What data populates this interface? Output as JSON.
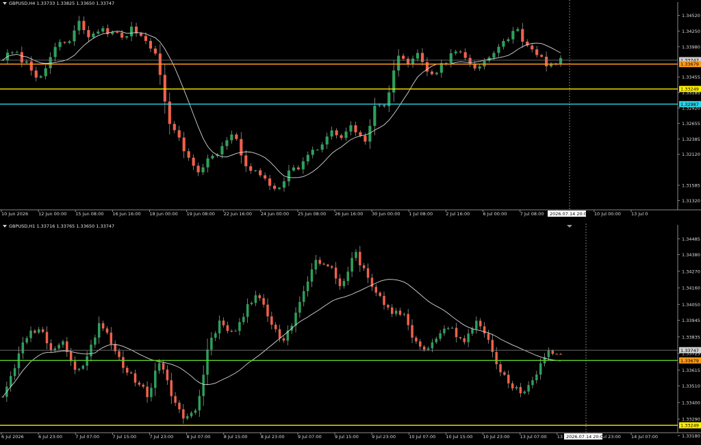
{
  "colors": {
    "background": "#000000",
    "bull": "#2ca05a",
    "bear": "#f0604a",
    "wick": "#b0b0b0",
    "ma": "#d8d8d8",
    "axis": "#8c8c8c",
    "text": "#dcdcdc",
    "orange": "#ff9a1a",
    "yellow": "#ffee00",
    "cyan": "#2ad4e6",
    "gray_line": "#8a8a8a",
    "green_line": "#5fd12c"
  },
  "chart_data": [
    {
      "type": "candlestick",
      "symbol_header": "GBPUSD,H4  1.33733 1.33825 1.33650 1.33747",
      "ylim": [
        1.3116,
        1.3468
      ],
      "yticks": [
        "1.34520",
        "1.34250",
        "1.33980",
        "1.33455",
        "1.33185",
        "1.32920",
        "1.32655",
        "1.32385",
        "1.32120",
        "1.31585",
        "1.31320"
      ],
      "ytick_values": [
        1.3452,
        1.3425,
        1.3398,
        1.33455,
        1.33185,
        1.3292,
        1.32655,
        1.32385,
        1.3212,
        1.31585,
        1.3132
      ],
      "xticks": [
        "10 Jun 2026",
        "12 Jun 00:00",
        "15 Jun 08:00",
        "16 Jun 16:00",
        "18 Jun 00:00",
        "19 Jun 08:00",
        "22 Jun 16:00",
        "24 Jun 00:00",
        "25 Jun 08:00",
        "26 Jun 16:00",
        "30 Jun 00:00",
        "1 Jul 08:00",
        "2 Jul 16:00",
        "6 Jul 00:00",
        "7 Jul 08:00",
        "8 Jul 16:00",
        "10 Jul 00:00",
        "13 Jul 0"
      ],
      "cursor_time": "2026.07.14 20:00",
      "levels": [
        {
          "label": "1.33747",
          "price": 1.33747,
          "color": "gray_line",
          "tag_bg": "#d0d0d0"
        },
        {
          "label": "1.33679",
          "price": 1.33679,
          "color": "orange",
          "tag_bg": "#ff9a1a"
        },
        {
          "label": "1.33249",
          "price": 1.33249,
          "color": "yellow",
          "tag_bg": "#ffee00"
        },
        {
          "label": "1.32987",
          "price": 1.32987,
          "color": "cyan",
          "tag_bg": "#2ad4e6"
        }
      ],
      "anchors": [
        1.3378,
        1.3388,
        1.3372,
        1.335,
        1.3355,
        1.3408,
        1.3402,
        1.344,
        1.341,
        1.3432,
        1.342,
        1.3415,
        1.343,
        1.341,
        1.339,
        1.328,
        1.324,
        1.3205,
        1.318,
        1.321,
        1.322,
        1.325,
        1.32,
        1.318,
        1.317,
        1.315,
        1.318,
        1.319,
        1.321,
        1.3225,
        1.325,
        1.324,
        1.326,
        1.323,
        1.329,
        1.33,
        1.338,
        1.337,
        1.3385,
        1.335,
        1.336,
        1.3385,
        1.339,
        1.336,
        1.3375,
        1.3385,
        1.341,
        1.343,
        1.3395,
        1.338,
        1.3365,
        1.3372
      ],
      "candles": 118,
      "seed": 7,
      "ma_period": 10
    },
    {
      "type": "candlestick",
      "symbol_header": "GBPUSD,H1  1.33716 1.33765 1.33650 1.33747",
      "ylim": [
        1.332,
        1.3455
      ],
      "yticks": [
        "1.34485",
        "1.34380",
        "1.34270",
        "1.34160",
        "1.34050",
        "1.33945",
        "1.33835",
        "1.33725",
        "1.33615",
        "1.33510",
        "1.33400",
        "1.33290",
        "1.33180"
      ],
      "ytick_values": [
        1.34485,
        1.3438,
        1.3427,
        1.3416,
        1.3405,
        1.33945,
        1.33835,
        1.33725,
        1.33615,
        1.3351,
        1.334,
        1.3329,
        1.3318
      ],
      "xticks": [
        "6 Jul 2026",
        "6 Jul 23:00",
        "7 Jul 07:00",
        "7 Jul 15:00",
        "7 Jul 23:00",
        "8 Jul 07:00",
        "8 Jul 15:00",
        "8 Jul 23:00",
        "9 Jul 07:00",
        "9 Jul 15:00",
        "9 Jul 23:00",
        "10 Jul 07:00",
        "10 Jul 15:00",
        "10 Jul 23:00",
        "13 Jul 07:00",
        "13 Jul 15:00",
        "13 Jul 23:00",
        "14 Jul 07:00"
      ],
      "cursor_time": "2026.07.14 20:00",
      "levels": [
        {
          "label": "1.33747",
          "price": 1.33747,
          "color": "gray_line",
          "tag_bg": "#d0d0d0"
        },
        {
          "label": "1.33679",
          "price": 1.33679,
          "color": "green_line",
          "tag_bg": "#ff9a1a"
        },
        {
          "label": "1.33249",
          "price": 1.33249,
          "color": "yellow",
          "tag_bg": "#ffee00"
        }
      ],
      "anchors": [
        1.3345,
        1.3365,
        1.3385,
        1.339,
        1.3375,
        1.338,
        1.336,
        1.337,
        1.3395,
        1.338,
        1.336,
        1.3355,
        1.3345,
        1.337,
        1.334,
        1.333,
        1.3335,
        1.338,
        1.3395,
        1.3385,
        1.34,
        1.3415,
        1.3395,
        1.338,
        1.3395,
        1.342,
        1.3435,
        1.343,
        1.3415,
        1.344,
        1.3425,
        1.341,
        1.3398,
        1.34,
        1.338,
        1.3375,
        1.3385,
        1.339,
        1.3378,
        1.3395,
        1.3385,
        1.336,
        1.335,
        1.3345,
        1.336,
        1.3375,
        1.3372
      ],
      "candles": 140,
      "seed": 11,
      "ma_period": 24
    }
  ]
}
